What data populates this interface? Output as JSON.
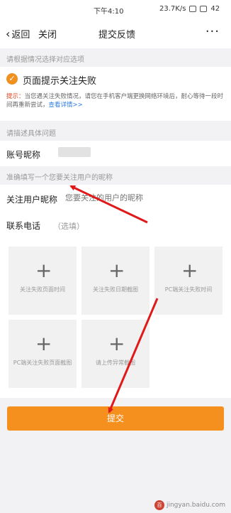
{
  "status_bar": {
    "time": "下午4:10",
    "net": "23.7K/s",
    "battery": "42"
  },
  "nav": {
    "back_label": "返回",
    "close_label": "关闭",
    "title": "提交反馈",
    "more": "···"
  },
  "reason_section": {
    "hint": "请根据情况选择对应选项",
    "selected_option": "页面提示关注失败"
  },
  "notice": {
    "lead": "提示：",
    "text": "当您遇关注失败情况，请您在手机客户端更换网络环境后，耐心等待一段时间再重新尝试，",
    "link": "查看详情>>"
  },
  "detail_section": {
    "hint": "请描述具体问题"
  },
  "fields": {
    "account_label": "账号昵称",
    "target_hint": "准确填写一个您要关注用户的昵称",
    "follow_label": "关注用户昵称",
    "follow_placeholder": "您要关注的用户的昵称",
    "phone_label": "联系电话",
    "phone_optional": "（选填）"
  },
  "uploads": [
    {
      "label": "关注失败页面时间"
    },
    {
      "label": "关注失败日期截图"
    },
    {
      "label": "PC端关注失败时间"
    },
    {
      "label": "PC端关注失败页面截图"
    },
    {
      "label": "请上传异常截图"
    }
  ],
  "submit_label": "提交",
  "watermark": {
    "logo": "百",
    "text": "jingyan.baidu.com"
  },
  "colors": {
    "accent": "#f5901f",
    "annotation_arrow": "#e0191b",
    "link": "#2f7de1"
  }
}
